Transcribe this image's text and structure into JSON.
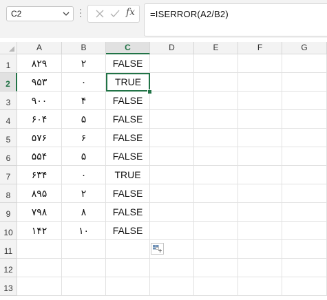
{
  "name_box": {
    "value": "C2"
  },
  "formula_bar": {
    "cancel_icon": "close-icon",
    "enter_icon": "check-icon",
    "fx_label": "fx",
    "formula": "=ISERROR(A2/B2)"
  },
  "sheet": {
    "columns": [
      "A",
      "B",
      "C",
      "D",
      "E",
      "F",
      "G"
    ],
    "active_column": "C",
    "rows": [
      "1",
      "2",
      "3",
      "4",
      "5",
      "6",
      "7",
      "8",
      "9",
      "10",
      "11",
      "12",
      "13"
    ],
    "active_row": "2",
    "data": [
      [
        "۸۲۹",
        "۲",
        "FALSE"
      ],
      [
        "۹۵۳",
        "۰",
        "TRUE"
      ],
      [
        "۹۰۰",
        "۴",
        "FALSE"
      ],
      [
        "۶۰۴",
        "۵",
        "FALSE"
      ],
      [
        "۵۷۶",
        "۶",
        "FALSE"
      ],
      [
        "۵۵۴",
        "۵",
        "FALSE"
      ],
      [
        "۶۳۴",
        "۰",
        "TRUE"
      ],
      [
        "۸۹۵",
        "۲",
        "FALSE"
      ],
      [
        "۷۹۸",
        "۸",
        "FALSE"
      ],
      [
        "۱۴۲",
        "۱۰",
        "FALSE"
      ]
    ],
    "selected_cell": "C2"
  },
  "quick_analysis": {
    "icon": "quick-analysis-icon"
  },
  "colors": {
    "accent": "#217346"
  }
}
